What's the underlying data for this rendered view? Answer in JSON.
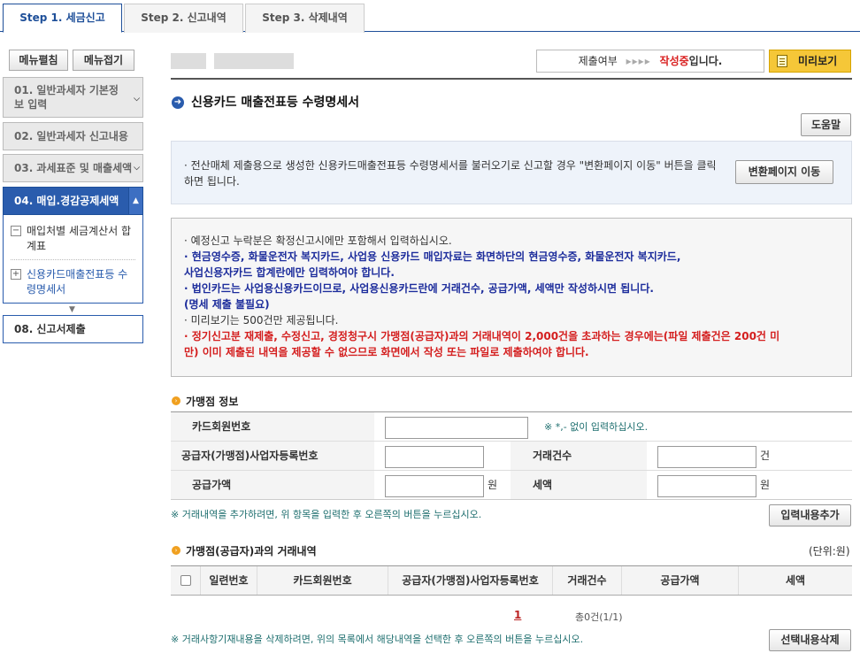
{
  "tabs": [
    "Step 1. 세금신고",
    "Step 2. 신고내역",
    "Step 3. 삭제내역"
  ],
  "sidebar": {
    "expand_label": "메뉴펼침",
    "collapse_label": "메뉴접기",
    "items": [
      {
        "label": "01. 일반과세자 기본정보 입력"
      },
      {
        "label": "02. 일반과세자 신고내용"
      },
      {
        "label": "03. 과세표준 및 매출세액"
      },
      {
        "label": "04. 매입.경감공제세액"
      },
      {
        "label": "08. 신고서제출"
      }
    ],
    "sub_items": [
      "매입처별 세금계산서 합계표",
      "신용카드매출전표등 수령명세서"
    ]
  },
  "status": {
    "label": "제출여부",
    "arrows": "▸▸▸▸",
    "state": "작성중",
    "suffix": "입니다."
  },
  "preview_label": "미리보기",
  "page_title": "신용카드 매출전표등 수령명세서",
  "help_label": "도움말",
  "info1": {
    "text": "· 전산매체 제출용으로 생성한 신용카드매출전표등 수령명세서를 불러오기로 신고할 경우  \"변환페이지 이동\" 버튼을 클릭하면 됩니다.",
    "button": "변환페이지 이동"
  },
  "notes": [
    {
      "text": "· 예정신고 누락분은 확정신고시에만 포함해서 입력하십시오.",
      "color": "black"
    },
    {
      "text": "· 현금영수증, 화물운전자 복지카드, 사업용 신용카드 매입자료는 화면하단의 현금영수증, 화물운전자 복지카드,",
      "color": "blue"
    },
    {
      "text": "  사업신용자카드 합계란에만 입력하여야 합니다.",
      "color": "blue"
    },
    {
      "text": "· 법인카드는 사업용신용카드이므로, 사업용신용카드란에 거래건수, 공급가액, 세액만 작성하시면 됩니다.",
      "color": "blue"
    },
    {
      "text": "  (명세 제출 불필요)",
      "color": "blue"
    },
    {
      "text": "· 미리보기는 500건만 제공됩니다.",
      "color": "black"
    },
    {
      "text": "· 정기신고분 재제출, 수정신고, 경정청구시 가맹점(공급자)과의 거래내역이 2,000건을 초과하는 경우에는(파일 제출건은 200건 미",
      "color": "red"
    },
    {
      "text": "  만) 이미 제출된 내역을 제공할 수 없으므로 화면에서 작성 또는 파일로 제출하여야 합니다.",
      "color": "red"
    }
  ],
  "merchant_section": {
    "title": "가맹점 정보",
    "card_no_label": "카드회원번호",
    "card_no_hint": "※ *,- 없이 입력하십시오.",
    "biz_no_label": "공급자(가맹점)사업자등록번호",
    "count_label": "거래건수",
    "count_unit": "건",
    "supply_label": "공급가액",
    "supply_unit": "원",
    "tax_label": "세액",
    "tax_unit": "원",
    "add_note": "※ 거래내역을 추가하려면, 위 항목을 입력한 후 오른쪽의 버튼을 누르십시오.",
    "add_button": "입력내용추가"
  },
  "list_section": {
    "title": "가맹점(공급자)과의 거래내역",
    "unit": "(단위:원)",
    "columns": [
      "일련번호",
      "카드회원번호",
      "공급자(가맹점)사업자등록번호",
      "거래건수",
      "공급가액",
      "세액"
    ],
    "page": "1",
    "count": "총0건(1/1)",
    "delete_note": "※ 거래사항기재내용을 삭제하려면, 위의 목록에서 해당내역을 선택한 후 오른쪽의 버튼을 누르십시오.",
    "delete_button": "선택내용삭제"
  }
}
